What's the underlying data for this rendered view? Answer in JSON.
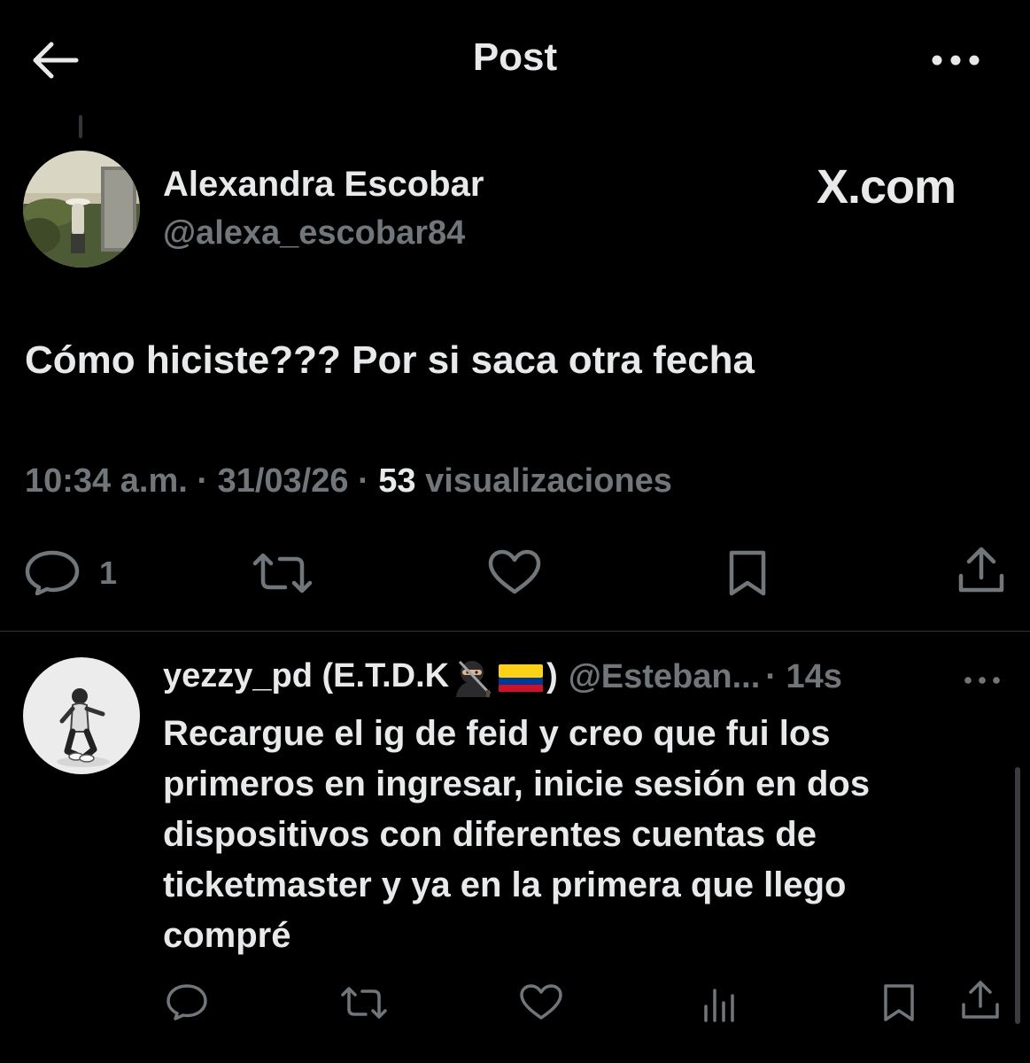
{
  "header": {
    "title": "Post"
  },
  "post": {
    "author_name": "Alexandra Escobar",
    "author_handle": "@alexa_escobar84",
    "source_label": "X.com",
    "text": "Cómo hiciste??? Por si saca otra fecha",
    "time": "10:34 a.m.",
    "date": "31/03/26",
    "views_count": "53",
    "views_label": "visualizaciones",
    "reply_count": "1"
  },
  "reply": {
    "name_prefix": "yezzy_pd (E.T.D.K",
    "name_suffix": ")",
    "handle": "@Esteban...",
    "time": "· 14s",
    "text": "Recargue el ig de feid y creo que fui los primeros en ingresar, inicie sesión en dos dispositivos con diferentes cuentas de ticketmaster y ya en la primera que llego compré"
  },
  "icons": {
    "back": "arrow-left-icon",
    "more": "more-horizontal-icon",
    "reply": "comment-bubble-icon",
    "repost": "repost-icon",
    "like": "heart-icon",
    "bookmark": "bookmark-icon",
    "share": "share-icon",
    "views": "analytics-bars-icon",
    "ninja_emoji": "ninja-emoji",
    "flag_emoji": "colombia-flag-emoji"
  },
  "colors": {
    "background": "#000000",
    "text_primary": "#e7e9ea",
    "text_secondary": "#71767b",
    "divider": "#2f3336",
    "flag_yellow": "#fcd116",
    "flag_blue": "#003893",
    "flag_red": "#ce1126"
  }
}
